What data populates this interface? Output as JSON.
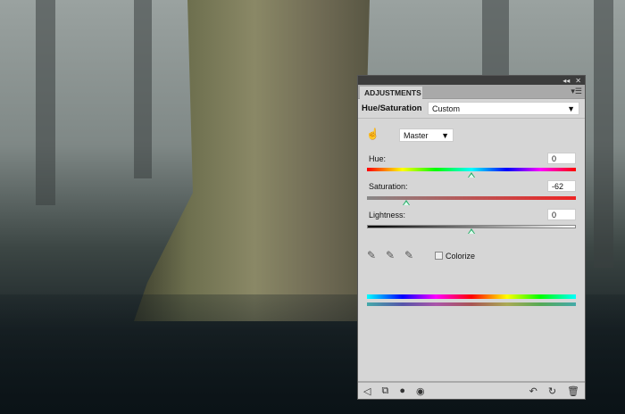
{
  "panel": {
    "tab": "ADJUSTMENTS",
    "adjustment_name": "Hue/Saturation",
    "preset": "Custom",
    "channel": "Master",
    "hue": {
      "label": "Hue:",
      "value": "0",
      "position": 0.5
    },
    "saturation": {
      "label": "Saturation:",
      "value": "-62",
      "position": 0.19
    },
    "lightness": {
      "label": "Lightness:",
      "value": "0",
      "position": 0.5
    },
    "colorize": {
      "label": "Colorize",
      "checked": false
    }
  },
  "icons": [
    "collapse-icon",
    "close-icon",
    "panel-menu-icon",
    "targeted-adjustment-hand-icon",
    "eyedropper-icon",
    "eyedropper-add-icon",
    "eyedropper-subtract-icon",
    "back-arrow-icon",
    "clip-to-layer-icon",
    "mask-icon",
    "visibility-eye-icon",
    "previous-state-icon",
    "reset-icon",
    "trash-icon"
  ]
}
